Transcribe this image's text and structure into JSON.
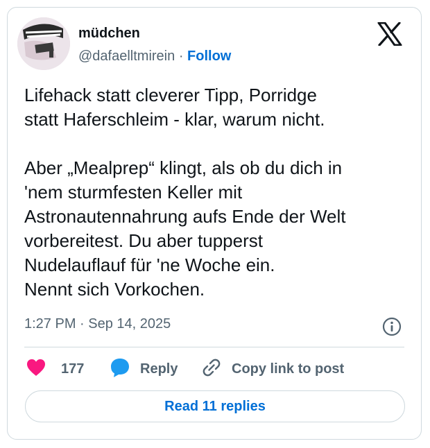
{
  "author": {
    "display_name": "müdchen",
    "handle": "@dafaelltmirein",
    "separator": "·",
    "follow_label": "Follow"
  },
  "tweet": {
    "paragraph_1": "Lifehack statt cleverer Tipp, Porridge\nstatt Haferschleim - klar, warum nicht.",
    "paragraph_2": "Aber „Mealprep“ klingt, als ob du dich in\n'nem sturmfesten Keller mit\nAstronautennahrung aufs Ende der Welt\nvorbereitest. Du aber tupperst\nNudelauflauf für 'ne Woche ein.\nNennt sich Vorkochen."
  },
  "meta": {
    "timestamp": "1:27 PM · Sep 14, 2025"
  },
  "actions": {
    "like_count": "177",
    "reply_label": "Reply",
    "copy_label": "Copy link to post"
  },
  "read_replies_label": "Read 11 replies",
  "colors": {
    "accent": "#006fd6",
    "like": "#f91880",
    "reply": "#1d9bf0",
    "muted": "#536471",
    "border": "#cfd9de"
  },
  "icons": [
    "x-logo-icon",
    "info-icon",
    "heart-icon",
    "speech-bubble-icon",
    "link-icon"
  ]
}
